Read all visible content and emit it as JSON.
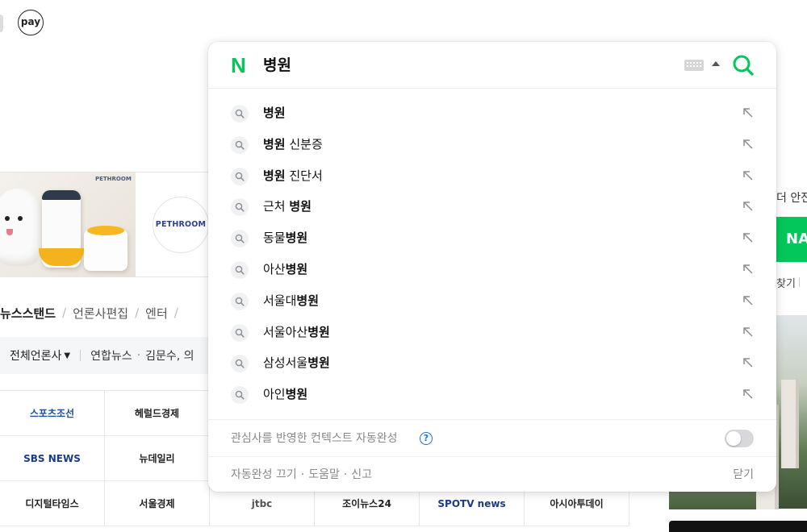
{
  "header": {
    "pay_label": "pay"
  },
  "ad": {
    "photo_brand": "PETHROOM",
    "logo_text": "PETHROOM"
  },
  "news": {
    "tabs": [
      {
        "label": "뉴스스탠드",
        "active": true
      },
      {
        "label": "언론사편집",
        "active": false
      },
      {
        "label": "엔터",
        "active": false
      }
    ],
    "filter_label": "전체언론사",
    "headline_source": "연합뉴스",
    "headline_text": "김문수, 의"
  },
  "press": [
    {
      "name": "스포츠조선",
      "color": "#1d4fa0"
    },
    {
      "name": "헤럴드경제",
      "color": "#222222"
    },
    {
      "name": "",
      "color": "#222222"
    },
    {
      "name": "",
      "color": "#222222"
    },
    {
      "name": "",
      "color": "#222222"
    },
    {
      "name": "",
      "color": "#222222"
    },
    {
      "name": "SBS NEWS",
      "color": "#1b3a8a"
    },
    {
      "name": "뉴데일리",
      "color": "#222222"
    },
    {
      "name": "",
      "color": "#222222"
    },
    {
      "name": "",
      "color": "#222222"
    },
    {
      "name": "",
      "color": "#222222"
    },
    {
      "name": "",
      "color": "#222222"
    },
    {
      "name": "디지털타임스",
      "color": "#222222"
    },
    {
      "name": "서울경제",
      "color": "#222222"
    },
    {
      "name": "jtbc",
      "color": "#555555"
    },
    {
      "name": "조이뉴스24",
      "color": "#222222"
    },
    {
      "name": "SPOTV news",
      "color": "#1b3a8a"
    },
    {
      "name": "아시아투데이",
      "color": "#222222"
    }
  ],
  "right_column": {
    "text_fragment": "더 안전",
    "naver_fragment": "NA",
    "sub_fragment": "찾기"
  },
  "autocomplete": {
    "query": "병원",
    "brand_color": "#03c75a",
    "suggestions": [
      {
        "bold": "병원",
        "rest": ""
      },
      {
        "bold": "병원",
        "rest": " 신분증"
      },
      {
        "bold": "병원",
        "rest": " 진단서"
      },
      {
        "pre": "근처 ",
        "bold": "병원",
        "rest": ""
      },
      {
        "pre": "동물",
        "bold": "병원",
        "rest": ""
      },
      {
        "pre": "아산",
        "bold": "병원",
        "rest": ""
      },
      {
        "pre": "서울대",
        "bold": "병원",
        "rest": ""
      },
      {
        "pre": "서울아산",
        "bold": "병원",
        "rest": ""
      },
      {
        "pre": "삼성서울",
        "bold": "병원",
        "rest": ""
      },
      {
        "pre": "아인",
        "bold": "병원",
        "rest": ""
      }
    ],
    "context_label": "관심사를 반영한 컨텍스트 자동완성",
    "context_enabled": false,
    "footer_links": [
      "자동완성 끄기",
      "도움말",
      "신고"
    ],
    "close_label": "닫기"
  }
}
